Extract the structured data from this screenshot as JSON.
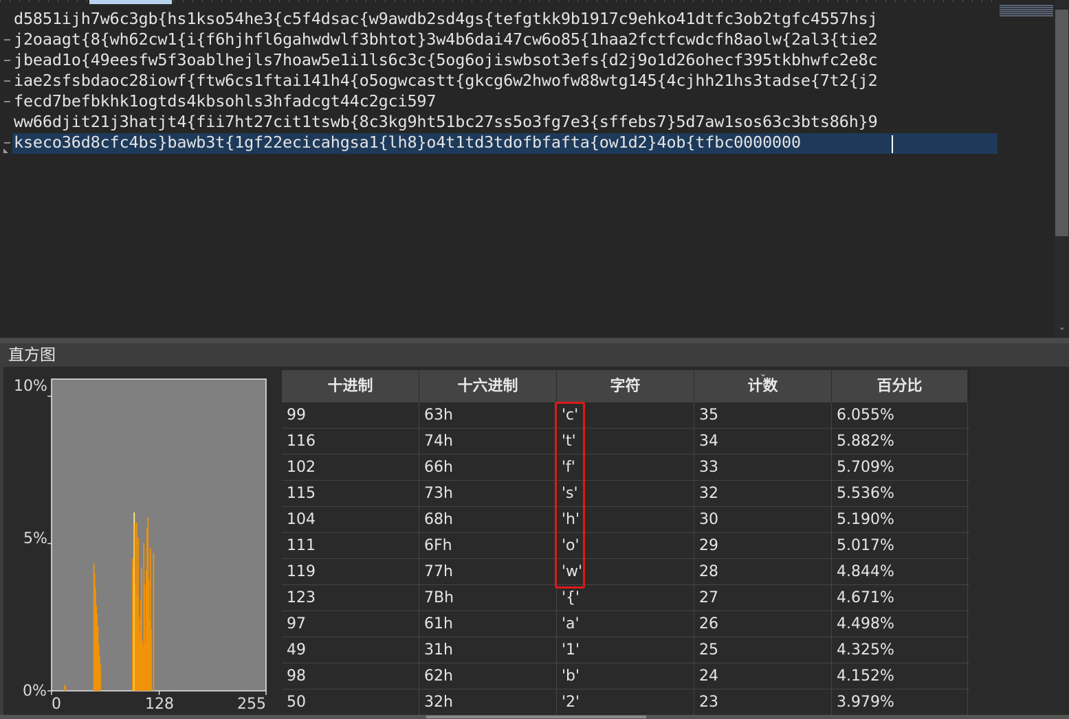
{
  "editor": {
    "lines": [
      "d5851ijh7w6c3gb{hs1kso54he3{c5f4dsac{w9awdb2sd4gs{tefgtkk9b1917c9ehko41dtfc3ob2tgfc4557hsj",
      "j2oaagt{8{wh62cw1{i{f6hjhfl6gahwdwlf3bhtot}3w4b6dai47cw6o85{1haa2fctfcwdcfh8aolw{2al3{tie2",
      "jbead1o{49eesfw5f3oablhejls7hoaw5e1i1ls6c3c{5og6ojiswbsot3efs{d2j9o1d26ohecf395tkbhwfc2e8c",
      "iae2sfsbdaoc28iowf{ftw6cs1ftai141h4{o5ogwcastt{gkcg6w2hwofw88wtg145{4cjhh21hs3tadse{7t2{j2",
      "fecd7befbkhk1ogtds4kbsohls3hfadcgt44c2gci597",
      "ww66djit21j3hatjt4{fii7ht27cit1tswb{8c3kg9ht51bc27ss5o3fg7e3{sffebs7}5d7aw1sos63c3bts86h}9",
      "kseco36d8cfc4bs}bawb3t{1gf22ecicahgsa1{lh8}o4t1td3tdofbfafta{ow1d2}4ob{tfbc0000000"
    ],
    "wrapped": [
      false,
      true,
      true,
      true,
      true,
      false,
      true
    ]
  },
  "panel": {
    "title": "直方图"
  },
  "chart_data": {
    "type": "bar",
    "title": "",
    "xlabel": "",
    "ylabel": "",
    "xlim": [
      0,
      255
    ],
    "ylim": [
      0,
      10
    ],
    "x_ticks": [
      "0",
      "128",
      "255"
    ],
    "y_ticks": [
      "10%",
      "5%",
      "0%"
    ],
    "grid": false,
    "legend": "none",
    "colors": {
      "bar": "#f0920a",
      "selected": "#f5f07a",
      "plot_bg": "#808080",
      "plot_border": "#e8e8e8"
    },
    "selected_x": 99,
    "series": [
      {
        "x": [
          13,
          14,
          49,
          50,
          51,
          52,
          53,
          54,
          55,
          56,
          57,
          97,
          98,
          99,
          100,
          101,
          102,
          103,
          104,
          105,
          106,
          107,
          108,
          109,
          110,
          111,
          112,
          113,
          114,
          115,
          116,
          117,
          118,
          119,
          120,
          123
        ],
        "values": [
          0.2,
          0.15,
          4.325,
          3.979,
          3.5,
          2.9,
          2.6,
          2.2,
          1.6,
          1.2,
          0.9,
          4.498,
          4.152,
          6.055,
          5.7,
          3.6,
          5.709,
          3.2,
          5.19,
          2.5,
          2.0,
          3.1,
          4.2,
          1.7,
          1.5,
          5.017,
          3.6,
          1.6,
          4.1,
          5.536,
          5.882,
          3.8,
          2.4,
          4.844,
          2.1,
          4.671
        ]
      }
    ]
  },
  "table": {
    "columns": [
      "十进制",
      "十六进制",
      "字符",
      "计数",
      "百分比"
    ],
    "sorted_column": "计数",
    "rows": [
      [
        "99",
        "63h",
        "'c'",
        "35",
        "6.055%"
      ],
      [
        "116",
        "74h",
        "'t'",
        "34",
        "5.882%"
      ],
      [
        "102",
        "66h",
        "'f'",
        "33",
        "5.709%"
      ],
      [
        "115",
        "73h",
        "'s'",
        "32",
        "5.536%"
      ],
      [
        "104",
        "68h",
        "'h'",
        "30",
        "5.190%"
      ],
      [
        "111",
        "6Fh",
        "'o'",
        "29",
        "5.017%"
      ],
      [
        "119",
        "77h",
        "'w'",
        "28",
        "4.844%"
      ],
      [
        "123",
        "7Bh",
        "'{'",
        "27",
        "4.671%"
      ],
      [
        "97",
        "61h",
        "'a'",
        "26",
        "4.498%"
      ],
      [
        "49",
        "31h",
        "'1'",
        "25",
        "4.325%"
      ],
      [
        "98",
        "62h",
        "'b'",
        "24",
        "4.152%"
      ],
      [
        "50",
        "32h",
        "'2'",
        "23",
        "3.979%"
      ]
    ]
  },
  "highlight": {
    "color": "#e01818",
    "column": "字符",
    "rows": 7
  }
}
